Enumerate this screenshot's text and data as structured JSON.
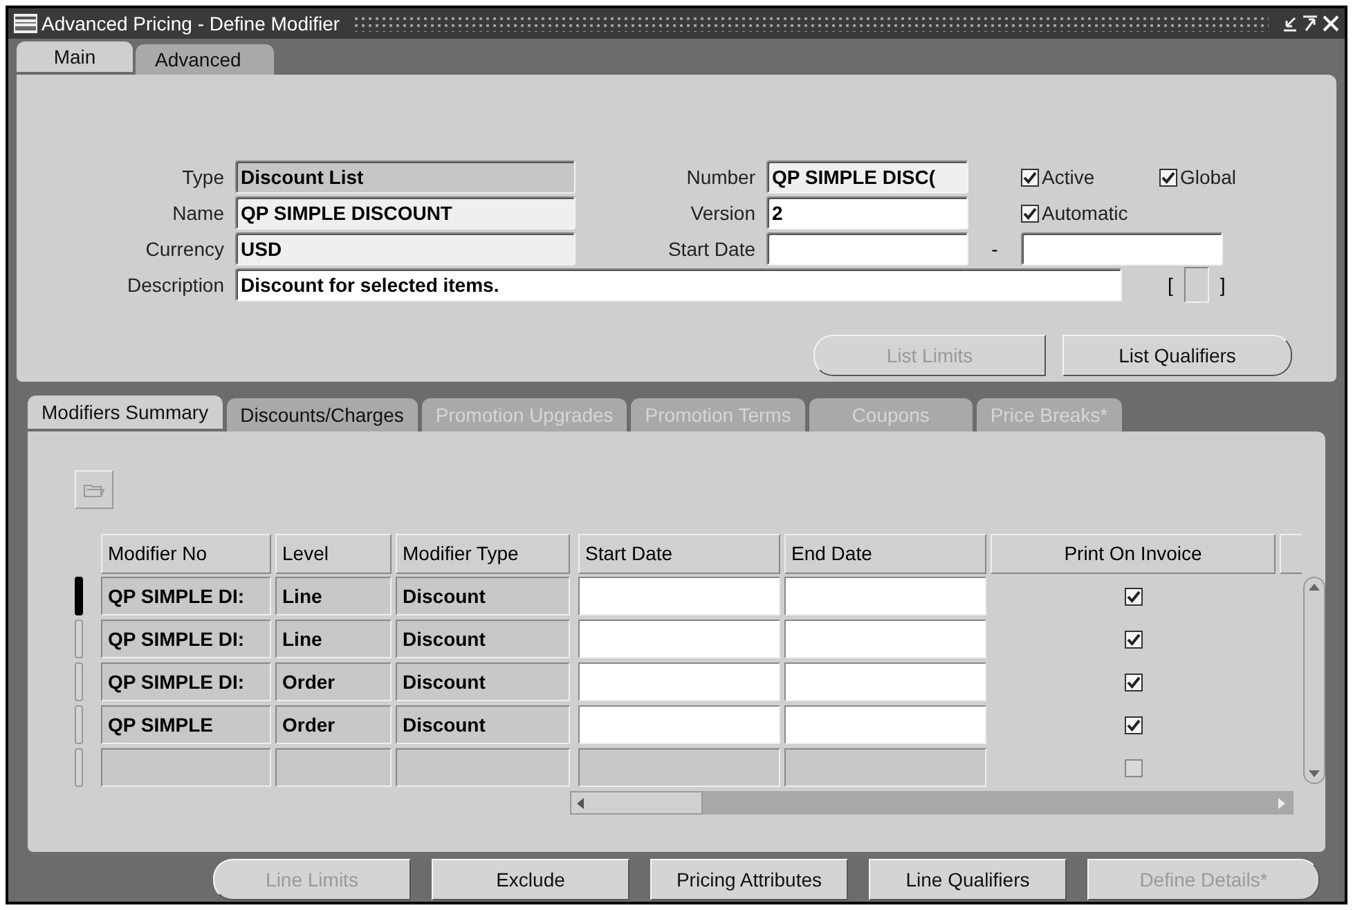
{
  "window": {
    "title": "Advanced Pricing - Define Modifier"
  },
  "main_tabs": [
    {
      "label": "Main",
      "selected": true
    },
    {
      "label": "Advanced",
      "selected": false
    }
  ],
  "header": {
    "type": {
      "label": "Type",
      "value": "Discount List",
      "kind": "display"
    },
    "name": {
      "label": "Name",
      "value": "QP SIMPLE DISCOUNT",
      "kind": "readonly"
    },
    "currency": {
      "label": "Currency",
      "value": "USD",
      "kind": "readonly"
    },
    "description": {
      "label": "Description",
      "value": "Discount for selected items.",
      "kind": "entry"
    },
    "number": {
      "label": "Number",
      "value": "QP SIMPLE DISC(",
      "kind": "readonly"
    },
    "version": {
      "label": "Version",
      "value": "2",
      "kind": "entry"
    },
    "start_date": {
      "label": "Start Date",
      "kind": "entry"
    },
    "date_separator": "-",
    "end_date": {
      "kind": "entry"
    },
    "active": {
      "label": "Active",
      "checked": true
    },
    "global": {
      "label": "Global",
      "checked": true
    },
    "automatic": {
      "label": "Automatic",
      "checked": true
    },
    "flex_open": "[",
    "flex_close": "]"
  },
  "header_buttons": [
    {
      "label": "List Limits",
      "disabled": true
    },
    {
      "label": "List Qualifiers",
      "disabled": false
    }
  ],
  "lower_tabs": [
    {
      "label": "Modifiers Summary",
      "selected": true,
      "disabled": false
    },
    {
      "label": "Discounts/Charges",
      "selected": false,
      "disabled": false
    },
    {
      "label": "Promotion Upgrades",
      "selected": false,
      "disabled": true
    },
    {
      "label": "Promotion Terms",
      "selected": false,
      "disabled": true
    },
    {
      "label": "Coupons",
      "selected": false,
      "disabled": true
    },
    {
      "label": "Price Breaks*",
      "selected": false,
      "disabled": true
    }
  ],
  "table": {
    "columns": [
      "Modifier No",
      "Level",
      "Modifier Type",
      "Start Date",
      "End Date",
      "Print On Invoice"
    ],
    "rows": [
      {
        "selected": true,
        "empty": false,
        "modifier_no": "QP SIMPLE DI:",
        "level": "Line",
        "modifier_type": "Discount",
        "print_on_invoice": true
      },
      {
        "selected": false,
        "empty": false,
        "modifier_no": "QP SIMPLE DI:",
        "level": "Line",
        "modifier_type": "Discount",
        "print_on_invoice": true
      },
      {
        "selected": false,
        "empty": false,
        "modifier_no": "QP SIMPLE DI:",
        "level": "Order",
        "modifier_type": "Discount",
        "print_on_invoice": true
      },
      {
        "selected": false,
        "empty": false,
        "modifier_no": "QP SIMPLE",
        "level": "Order",
        "modifier_type": "Discount",
        "print_on_invoice": true
      },
      {
        "selected": false,
        "empty": true,
        "print_on_invoice": false
      }
    ]
  },
  "bottom_buttons": [
    {
      "label": "Line Limits",
      "disabled": true
    },
    {
      "label": "Exclude",
      "disabled": false
    },
    {
      "label": "Pricing Attributes",
      "disabled": false
    },
    {
      "label": "Line Qualifiers",
      "disabled": false
    },
    {
      "label": "Define Details*",
      "disabled": true
    }
  ]
}
